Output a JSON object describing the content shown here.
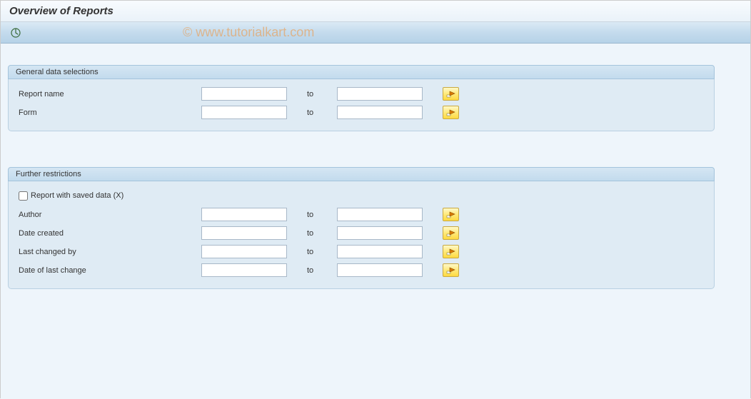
{
  "header": {
    "title": "Overview of Reports"
  },
  "watermark": "© www.tutorialkart.com",
  "groups": {
    "general": {
      "title": "General data selections",
      "rows": {
        "report_name": {
          "label": "Report name",
          "to": "to",
          "from_val": "",
          "to_val": ""
        },
        "form": {
          "label": "Form",
          "to": "to",
          "from_val": "",
          "to_val": ""
        }
      }
    },
    "further": {
      "title": "Further restrictions",
      "checkbox": {
        "label": "Report with saved data (X)",
        "checked": false
      },
      "rows": {
        "author": {
          "label": "Author",
          "to": "to",
          "from_val": "",
          "to_val": ""
        },
        "date_created": {
          "label": "Date created",
          "to": "to",
          "from_val": "",
          "to_val": ""
        },
        "last_changed": {
          "label": "Last changed by",
          "to": "to",
          "from_val": "",
          "to_val": ""
        },
        "date_last": {
          "label": "Date of last change",
          "to": "to",
          "from_val": "",
          "to_val": ""
        }
      }
    }
  }
}
